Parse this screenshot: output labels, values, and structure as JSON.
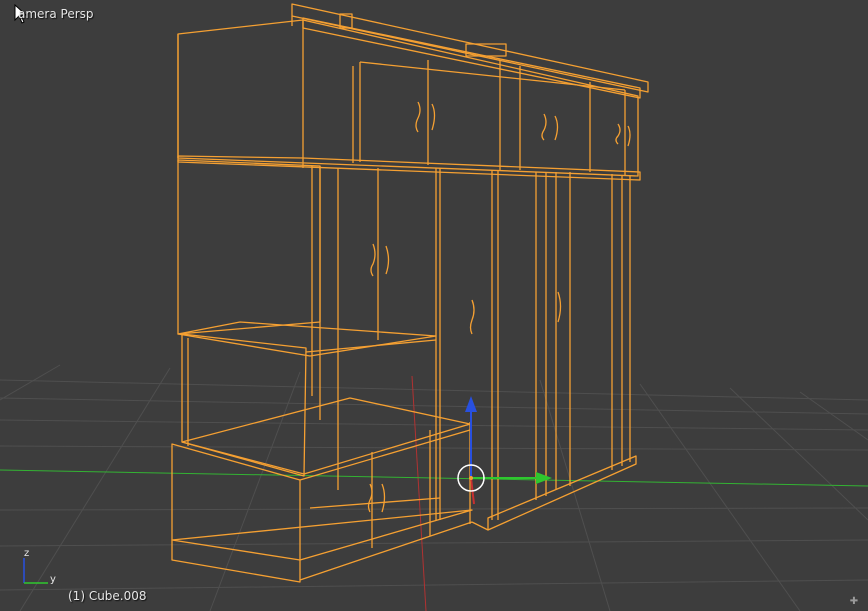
{
  "viewport": {
    "view_name": "amera Persp",
    "object_info": "(1) Cube.008",
    "mini_axes": {
      "z": "z",
      "y": "y"
    }
  },
  "colors": {
    "background": "#3d3d3d",
    "grid": "#4f4f4f",
    "selection": "#f5a032",
    "x_axis": "#b03232",
    "y_axis": "#33b333",
    "z_arrow": "#2850e0",
    "y_arrow": "#2ec82e",
    "text": "#e6e6e6"
  },
  "icons": {
    "cursor": "mouse-pointer-icon",
    "transform_gizmo": "transform-manipulator-icon",
    "corner_handle": "area-split-handle-icon"
  }
}
